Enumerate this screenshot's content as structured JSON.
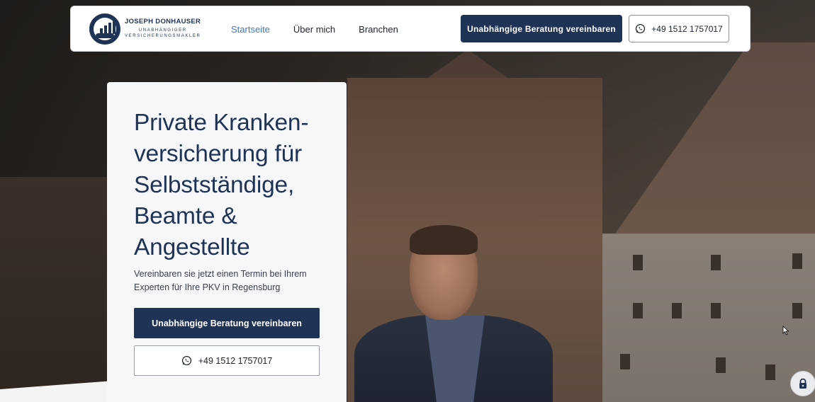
{
  "brand": {
    "name": "JOSEPH DONHAUSER",
    "subtitle_line1": "UNABHÄNGIGER",
    "subtitle_line2": "VERSICHERUNGSMAKLER"
  },
  "nav": {
    "items": [
      {
        "label": "Startseite",
        "active": true
      },
      {
        "label": "Über mich",
        "active": false
      },
      {
        "label": "Branchen",
        "active": false
      }
    ]
  },
  "header": {
    "cta_label": "Unabhängige Beratung vereinbaren",
    "phone_label": "+49 1512 1757017"
  },
  "hero": {
    "heading_lines": [
      "Private Kranken-",
      "versicherung für",
      "Selbstständige,",
      "Beamte &",
      "Angestellte"
    ],
    "subtext": "Vereinbaren sie jetzt einen Termin bei Ihrem Experten für Ihre PKV in Regensburg",
    "cta_label": "Unabhängige Beratung vereinbaren",
    "phone_label": "+49 1512 1757017"
  },
  "widgets": {
    "lock_icon": "lock-icon",
    "whatsapp_icon": "whatsapp-icon"
  },
  "colors": {
    "primary": "#1f3357",
    "nav_active": "#3a78c8",
    "card_bg": "#f6f7f9"
  }
}
